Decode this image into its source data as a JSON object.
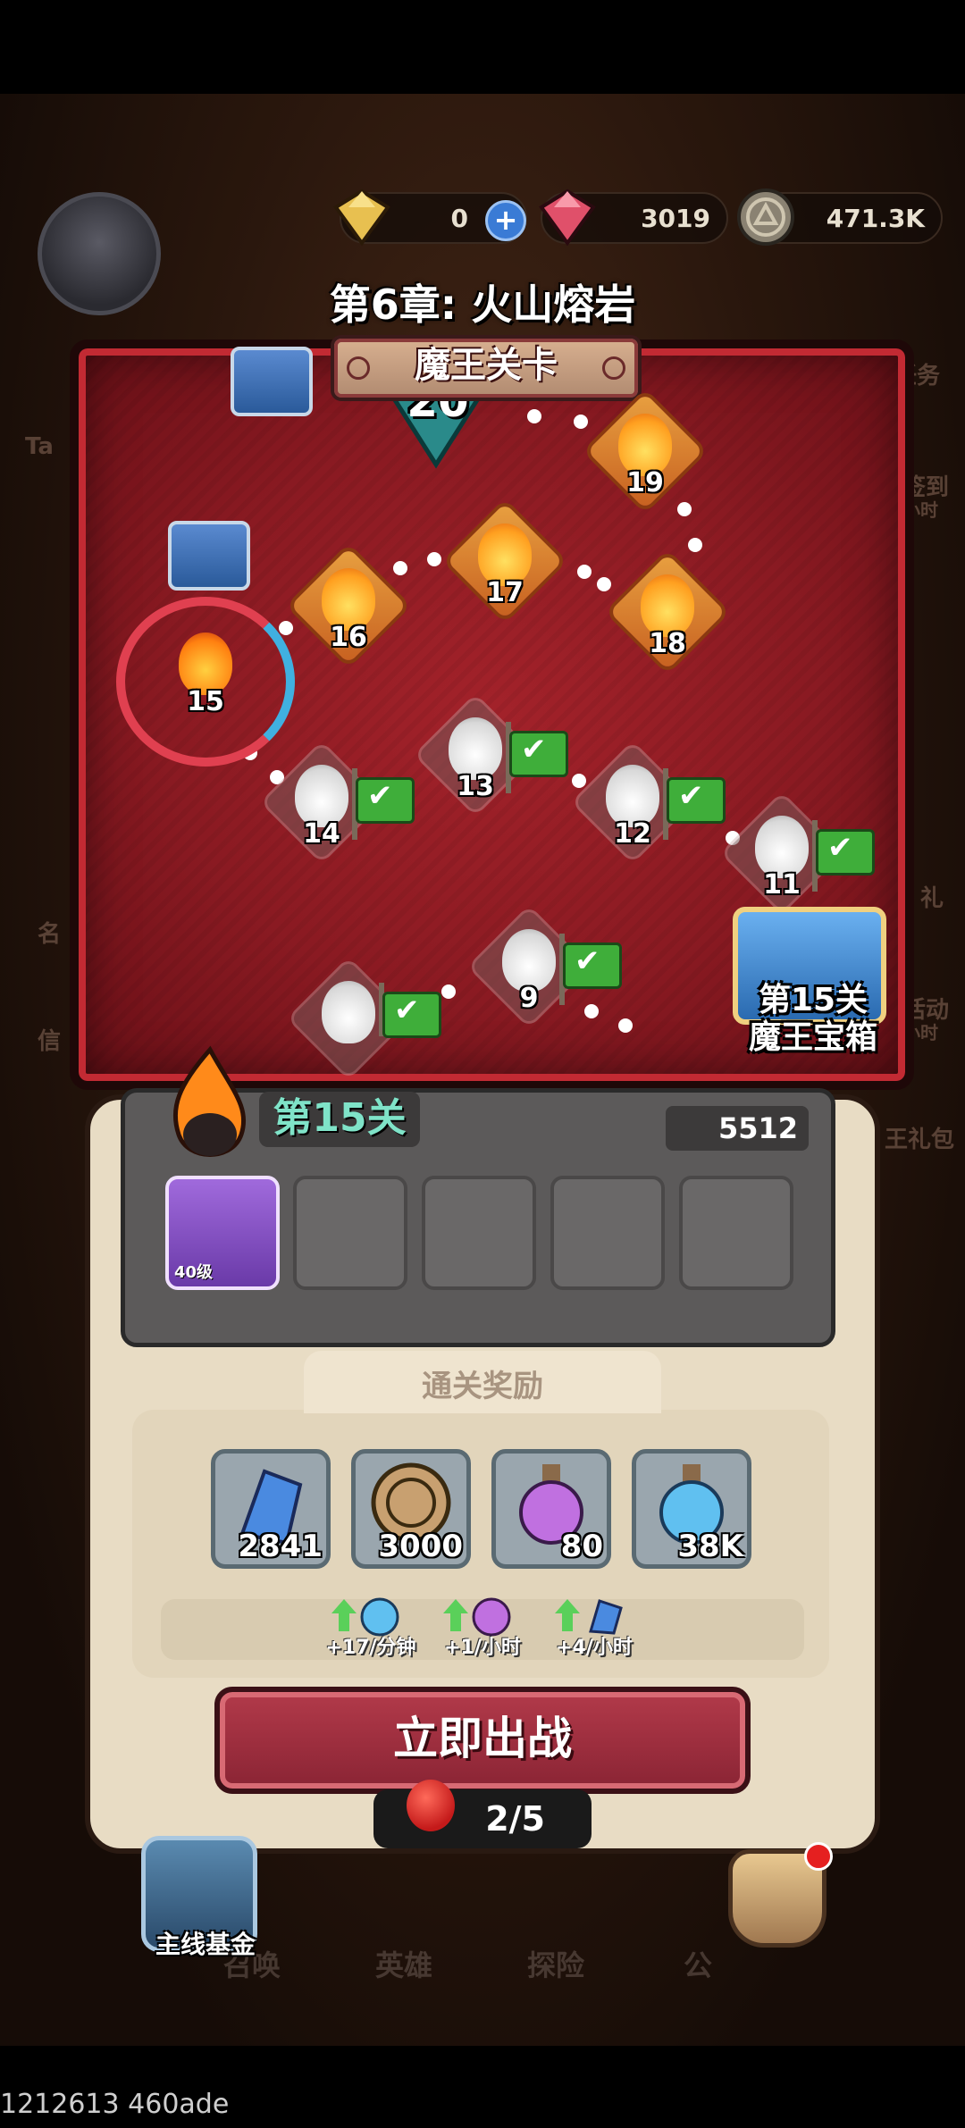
{
  "currency": {
    "premium": {
      "value": "0",
      "icon": "yellow-gem-icon"
    },
    "gems": {
      "value": "3019",
      "icon": "red-gem-icon"
    },
    "coins": {
      "value": "471.3K",
      "icon": "coin-icon"
    }
  },
  "chapter": {
    "title": "第6章: 火山熔岩",
    "banner": "魔王关卡"
  },
  "map": {
    "nodes": [
      {
        "num": "20",
        "state": "boss"
      },
      {
        "num": "19",
        "state": "locked"
      },
      {
        "num": "18",
        "state": "locked"
      },
      {
        "num": "17",
        "state": "locked"
      },
      {
        "num": "16",
        "state": "locked"
      },
      {
        "num": "15",
        "state": "current"
      },
      {
        "num": "14",
        "state": "cleared"
      },
      {
        "num": "13",
        "state": "cleared"
      },
      {
        "num": "12",
        "state": "cleared"
      },
      {
        "num": "11",
        "state": "cleared"
      },
      {
        "num": "9",
        "state": "cleared"
      }
    ],
    "boss_chest_line1": "第15关",
    "boss_chest_line2": "魔王宝箱"
  },
  "side_menu": {
    "right": [
      "任务",
      "签到",
      "小时",
      "礼",
      "活动",
      "小时",
      "王礼包"
    ],
    "left": [
      "Ta",
      "名",
      "信"
    ]
  },
  "stage": {
    "title": "第15关",
    "power": "5512",
    "hero": {
      "level": "40级"
    }
  },
  "rewards": {
    "title": "通关奖励",
    "items": [
      {
        "icon": "crystal-icon",
        "value": "2841",
        "color": "#9aa6ae"
      },
      {
        "icon": "coin-icon",
        "value": "3000",
        "color": "#9aa6ae"
      },
      {
        "icon": "purple-potion-icon",
        "value": "80",
        "color": "#9aa6ae"
      },
      {
        "icon": "blue-potion-icon",
        "value": "38K",
        "color": "#9aa6ae"
      }
    ],
    "rates": [
      {
        "icon": "blue-potion-icon",
        "label": "+17/分钟"
      },
      {
        "icon": "purple-potion-icon",
        "label": "+1/小时"
      },
      {
        "icon": "crystal-icon",
        "label": "+4/小时"
      }
    ]
  },
  "battle": {
    "label": "立即出战",
    "stamina": "2/5"
  },
  "nav": {
    "fund_label": "主线基金",
    "items": [
      "召唤",
      "英雄",
      "探险",
      "公"
    ]
  },
  "device_id": "1212613 460ade"
}
